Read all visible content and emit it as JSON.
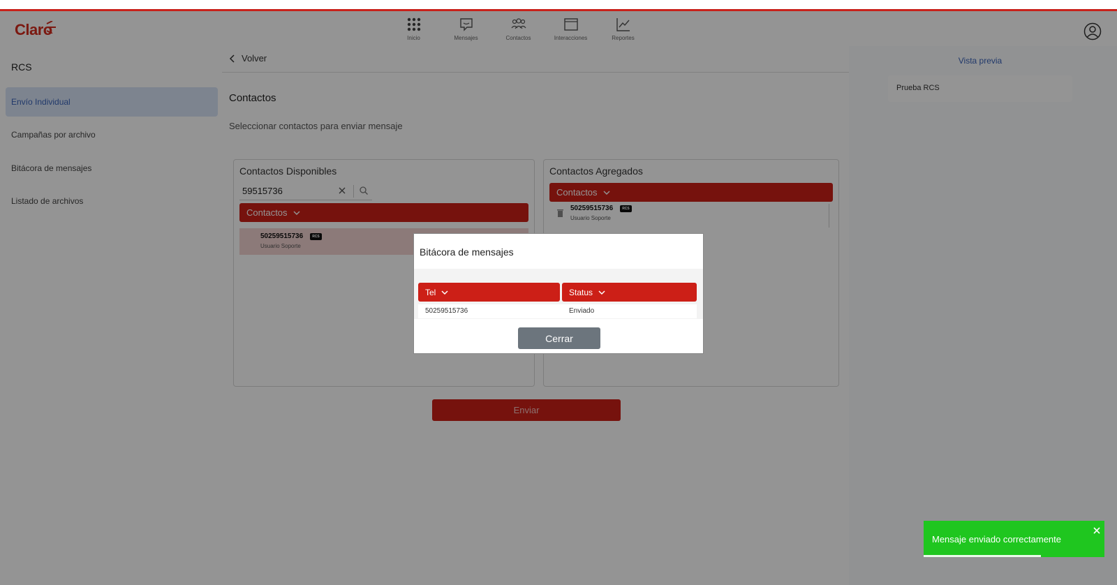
{
  "header": {
    "logo_text": "Claro",
    "nav": [
      {
        "label": "Inicio",
        "icon": "grid-icon"
      },
      {
        "label": "Mensajes",
        "icon": "message-icon"
      },
      {
        "label": "Contactos",
        "icon": "users-icon"
      },
      {
        "label": "Interacciones",
        "icon": "window-icon"
      },
      {
        "label": "Reportes",
        "icon": "chart-icon"
      }
    ]
  },
  "sidebar": {
    "title": "RCS",
    "items": [
      {
        "label": "Envío Individual",
        "active": true
      },
      {
        "label": "Campañas por archivo",
        "active": false
      },
      {
        "label": "Bitácora de mensajes",
        "active": false
      },
      {
        "label": "Listado de archivos",
        "active": false
      }
    ]
  },
  "main": {
    "back_label": "Volver",
    "title": "Contactos",
    "subtitle": "Seleccionar contactos para enviar mensaje",
    "available": {
      "title": "Contactos Disponibles",
      "search_value": "59515736",
      "header_label": "Contactos",
      "contact": {
        "number": "50259515736",
        "badge": "RCS",
        "name": "Usuario Soporte"
      }
    },
    "added": {
      "title": "Contactos Agregados",
      "header_label": "Contactos",
      "contact": {
        "number": "50259515736",
        "badge": "RCS",
        "name": "Usuario Soporte"
      }
    },
    "send_label": "Enviar"
  },
  "preview": {
    "title": "Vista previa",
    "message": "Prueba RCS"
  },
  "modal": {
    "title": "Bitácora de mensajes",
    "columns": [
      "Tel",
      "Status"
    ],
    "rows": [
      {
        "tel": "50259515736",
        "status": "Enviado"
      }
    ],
    "close_label": "Cerrar"
  },
  "toast": {
    "message": "Mensaje enviado correctamente",
    "progress": 0.65
  },
  "colors": {
    "brand_red": "#cc1f17",
    "accent_blue": "#3a63b8",
    "success_green": "#1fc61f",
    "button_gray": "#6c757d"
  }
}
